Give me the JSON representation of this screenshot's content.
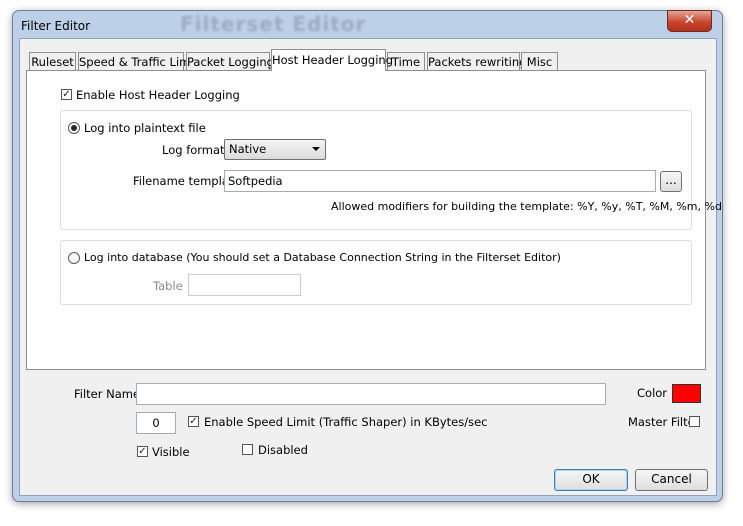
{
  "window": {
    "title": "Filter Editor",
    "background_title": "Filterset Editor",
    "close_symbol": "✕"
  },
  "tabs": [
    {
      "label": "Ruleset"
    },
    {
      "label": "Speed & Traffic Limit"
    },
    {
      "label": "Packet Logging"
    },
    {
      "label": "Host Header Logging"
    },
    {
      "label": "Time"
    },
    {
      "label": "Packets rewriting"
    },
    {
      "label": "Misc"
    }
  ],
  "host_header": {
    "enable_label": "Enable Host Header Logging",
    "enable_checked": true,
    "plaintext_label": "Log into plaintext file",
    "plaintext_selected": true,
    "log_format_label": "Log format",
    "log_format_value": "Native",
    "filename_label": "Filename template",
    "filename_value": "Softpedia",
    "browse_label": "...",
    "modifiers_text": "Allowed modifiers for building the template: %Y, %y, %T, %M, %m, %d",
    "database_label": "Log into database (You should set a Database Connection String in the Filterset Editor)",
    "database_selected": false,
    "table_label": "Table",
    "table_value": ""
  },
  "footer": {
    "filter_name_label": "Filter Name",
    "filter_name_value": "",
    "color_label": "Color",
    "color_value": "#ff0000",
    "speed_value": "0",
    "speed_limit_label": "Enable Speed Limit (Traffic Shaper) in KBytes/sec",
    "speed_limit_checked": true,
    "master_filter_label": "Master Filter",
    "master_filter_checked": false,
    "visible_label": "Visible",
    "visible_checked": true,
    "disabled_label": "Disabled",
    "disabled_checked": false,
    "ok_label": "OK",
    "cancel_label": "Cancel"
  }
}
